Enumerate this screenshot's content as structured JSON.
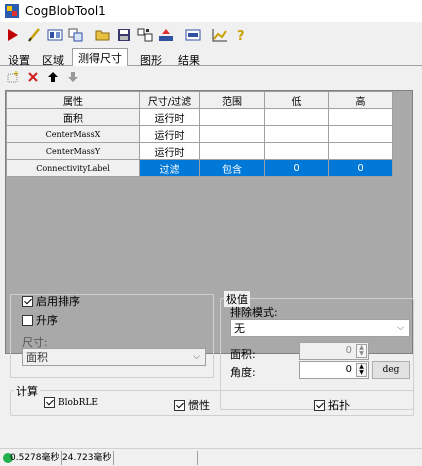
{
  "window": {
    "title": "CogBlobTool1"
  },
  "toolbar": {
    "icons": [
      "run-icon",
      "edit-icon",
      "image-icon",
      "copy-icon",
      "open-icon",
      "save-icon",
      "settings-icon",
      "load-icon",
      "counter-icon",
      "graph-icon",
      "help-icon"
    ]
  },
  "tabs": [
    "设置",
    "区域",
    "测得尺寸",
    "图形",
    "结果"
  ],
  "active_tab": "测得尺寸",
  "grid": {
    "headers": [
      "属性",
      "尺寸/过滤",
      "范围",
      "低",
      "高"
    ],
    "rows": [
      {
        "name": "面积",
        "mode": "运行时",
        "range": "",
        "low": "",
        "high": ""
      },
      {
        "name": "CenterMassX",
        "mode": "运行时",
        "range": "",
        "low": "",
        "high": ""
      },
      {
        "name": "CenterMassY",
        "mode": "运行时",
        "range": "",
        "low": "",
        "high": ""
      },
      {
        "name": "ConnectivityLabel",
        "mode": "过滤",
        "range": "包含",
        "low": "0",
        "high": "0"
      }
    ],
    "selected_row": 3
  },
  "sort": {
    "enable_label": "启用排序",
    "enable_checked": true,
    "ascending_label": "升序",
    "ascending_checked": false,
    "size_label": "尺寸:",
    "size_value": "面积"
  },
  "extreme": {
    "group_label": "极值",
    "mode_label": "排除模式:",
    "mode_value": "无",
    "area_label": "面积:",
    "area_value": "0",
    "angle_label": "角度:",
    "angle_value": "0",
    "unit_button": "deg"
  },
  "compute": {
    "group_label": "计算",
    "items": [
      {
        "label": "BlobRLE",
        "checked": true
      },
      {
        "label": "惯性",
        "checked": true
      },
      {
        "label": "拓扑",
        "checked": true
      }
    ]
  },
  "status": {
    "time1": "0.5278毫秒",
    "time2": "24.723毫秒"
  },
  "colors": {
    "selection": "#0078d7",
    "ok": "#22b14c"
  }
}
